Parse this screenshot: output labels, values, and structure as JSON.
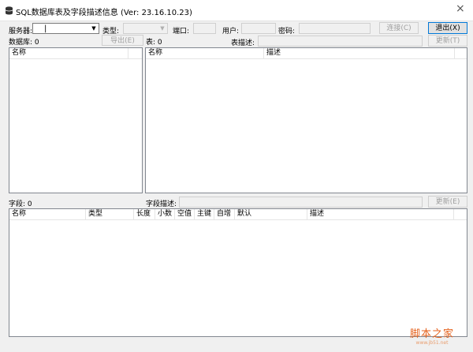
{
  "window": {
    "title": "SQL数据库表及字段描述信息 (Ver: 23.16.10.23)",
    "close_glyph": "×",
    "app_icon": "database-icon"
  },
  "connection": {
    "server_label": "服务器:",
    "server_value": "|",
    "type_label": "类型:",
    "type_value": "",
    "port_label": "端口:",
    "port_value": "",
    "user_label": "用户:",
    "user_value": "",
    "password_label": "密码:",
    "password_value": "",
    "connect_button": "连接(C)",
    "exit_button": "退出(X)"
  },
  "database": {
    "count_label": "数据库: 0",
    "export_button": "导出(E)",
    "columns": [
      "名称"
    ]
  },
  "tables": {
    "count_label": "表: 0",
    "desc_label": "表描述:",
    "desc_value": "",
    "update_button": "更新(T)",
    "columns": [
      "名称",
      "描述"
    ]
  },
  "fields": {
    "count_label": "字段: 0",
    "desc_label": "字段描述:",
    "desc_value": "",
    "update_button": "更新(E)",
    "columns": [
      "名称",
      "类型",
      "长度",
      "小数",
      "空值",
      "主键",
      "自增",
      "默认",
      "描述"
    ]
  },
  "watermark": {
    "main": "脚本之家",
    "sub": "www.jb51.net"
  }
}
